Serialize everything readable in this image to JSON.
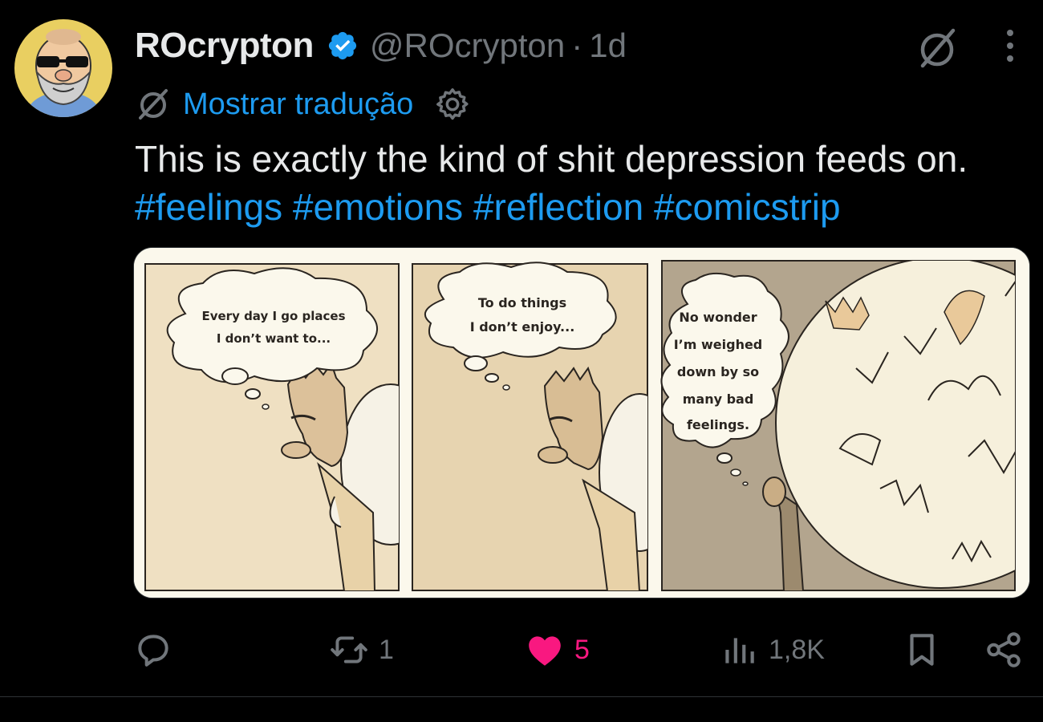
{
  "author": {
    "display_name": "ROcrypton",
    "handle": "@ROcrypton",
    "separator": "·",
    "time": "1d"
  },
  "translate": {
    "label": "Mostrar tradução"
  },
  "tweet": {
    "text": "This is exactly the kind of shit depression feeds on.",
    "hashtags": [
      "#feelings",
      "#emotions",
      "#reflection",
      "#comicstrip"
    ]
  },
  "comic": {
    "panel1": [
      "Every day I go places",
      "I don’t want to..."
    ],
    "panel2": [
      "To do things",
      "I don’t enjoy..."
    ],
    "panel3": [
      "No wonder",
      "I’m weighed",
      "down by so",
      "many bad",
      "feelings."
    ]
  },
  "actions": {
    "replies": "",
    "reposts": "1",
    "likes": "5",
    "views": "1,8K"
  },
  "colors": {
    "accent": "#1d9bf0",
    "like": "#f91880",
    "muted": "#71767b",
    "text": "#e7e9ea",
    "background": "#000000"
  },
  "icons": [
    "avatar",
    "verified-badge-icon",
    "grok-icon",
    "more-icon",
    "translate-icon",
    "settings-icon",
    "reply-icon",
    "repost-icon",
    "like-icon",
    "views-icon",
    "bookmark-icon",
    "share-icon"
  ]
}
